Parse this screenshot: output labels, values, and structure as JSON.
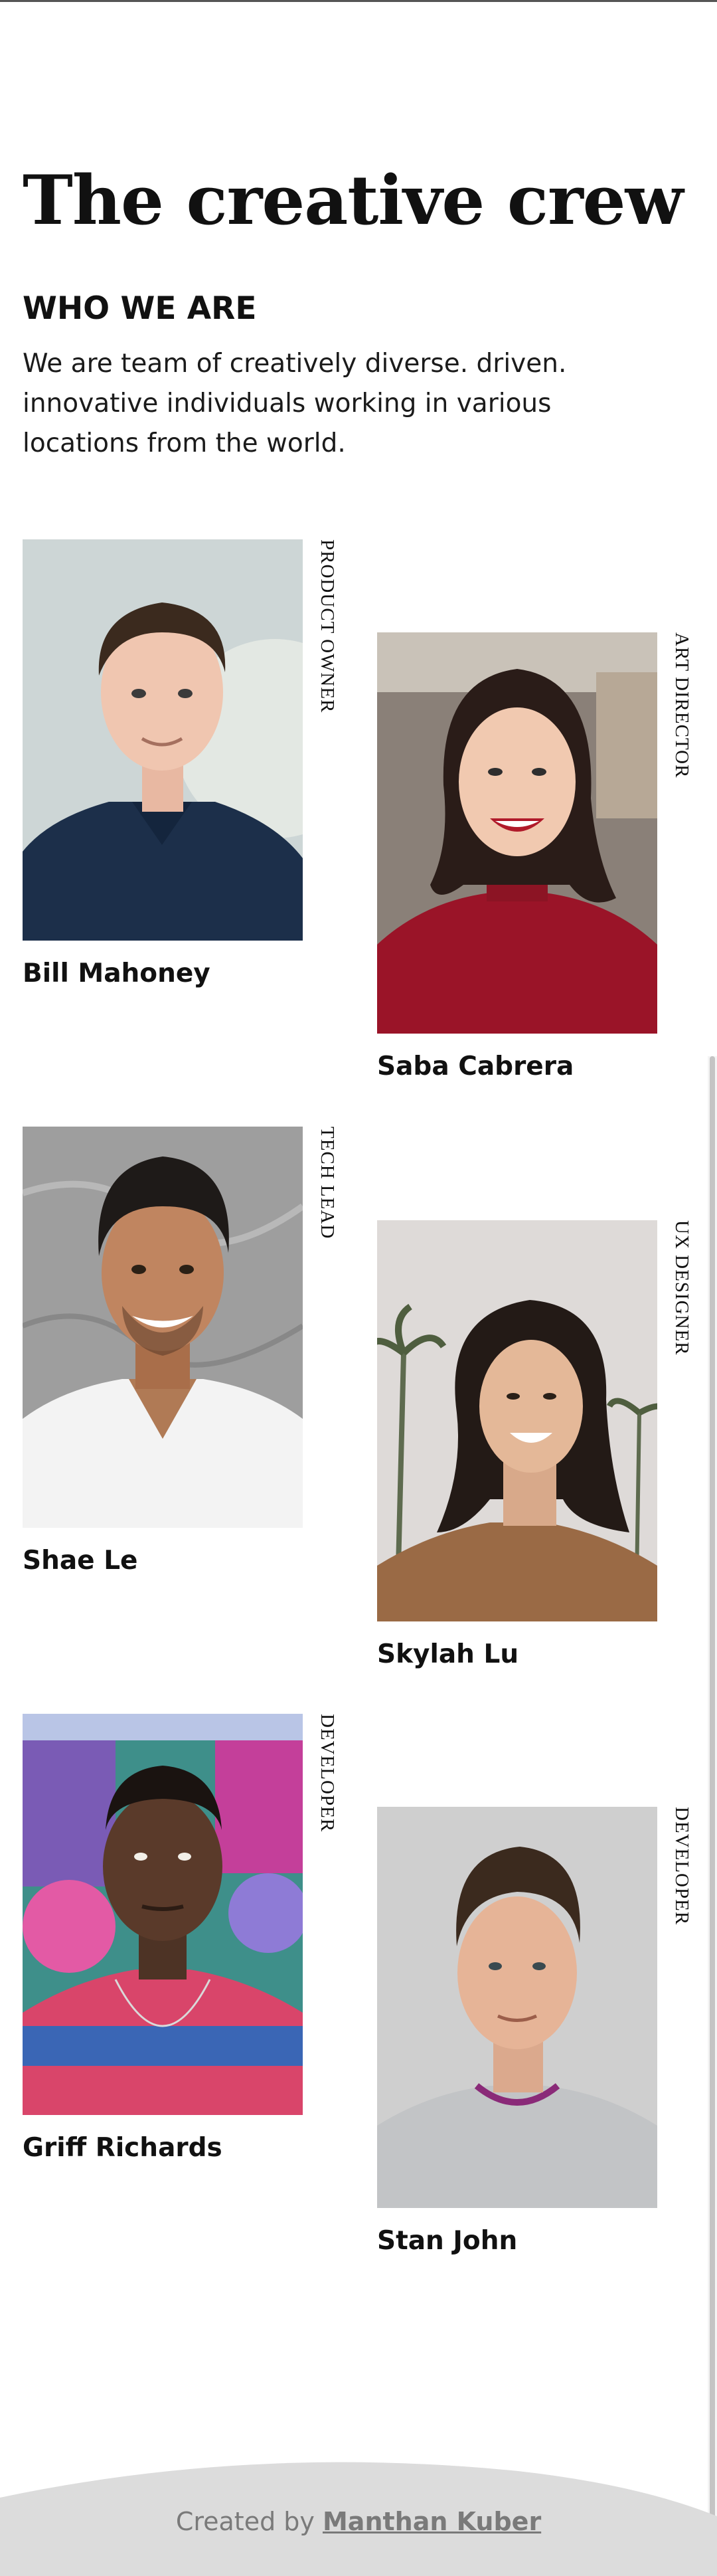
{
  "header": {
    "title": "The creative crew"
  },
  "about": {
    "heading": "WHO WE ARE",
    "text": "We are team of creatively diverse. driven. innovative individuals working in various locations from the world."
  },
  "team": [
    {
      "name": "Bill Mahoney",
      "role": "PRODUCT OWNER"
    },
    {
      "name": "Saba Cabrera",
      "role": "ART DIRECTOR"
    },
    {
      "name": "Shae Le",
      "role": "TECH LEAD"
    },
    {
      "name": "Skylah Lu",
      "role": "UX DESIGNER"
    },
    {
      "name": "Griff Richards",
      "role": "DEVELOPER"
    },
    {
      "name": "Stan John",
      "role": "DEVELOPER"
    }
  ],
  "footer": {
    "prefix": "Created by",
    "author": "Manthan Kuber"
  }
}
